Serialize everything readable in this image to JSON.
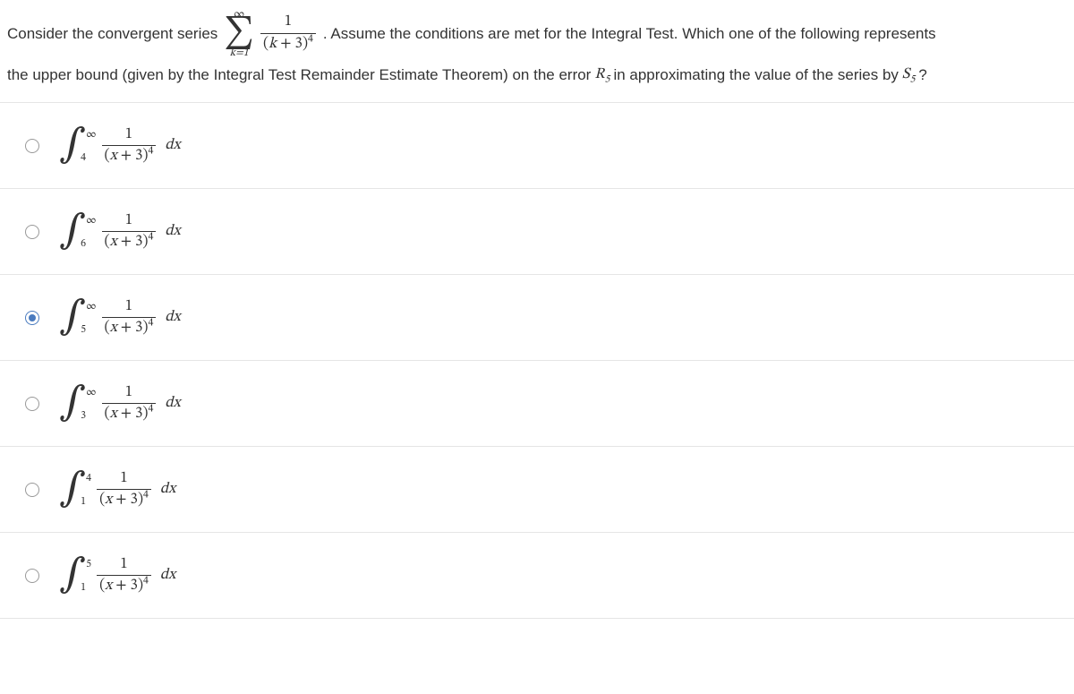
{
  "question": {
    "text_before_series": "Consider the convergent series",
    "series": {
      "sum_upper": "∞",
      "sum_symbol": "∑",
      "sum_lower": "k=1",
      "frac_num": "1",
      "frac_den_open": "(",
      "frac_den_var": "k",
      "frac_den_plus": " + 3)",
      "frac_den_exp": "4"
    },
    "text_middle": ". Assume the conditions are met for the Integral Test. Which one of the following represents",
    "text_second_line_a": "the upper bound (given by the Integral Test Remainder Estimate Theorem) on the error ",
    "r_var": "R",
    "r_sub": "5",
    "text_second_line_b": " in approximating the value of the series by ",
    "s_var": "S",
    "s_sub": "5",
    "text_end": " ?"
  },
  "integrand": {
    "num": "1",
    "den_open": "(",
    "den_var": "x",
    "den_plus": " + 3)",
    "den_exp": "4",
    "dx": "dx"
  },
  "options": [
    {
      "id": "a",
      "lower": "4",
      "upper": "∞",
      "selected": false
    },
    {
      "id": "b",
      "lower": "6",
      "upper": "∞",
      "selected": false
    },
    {
      "id": "c",
      "lower": "5",
      "upper": "∞",
      "selected": true
    },
    {
      "id": "d",
      "lower": "3",
      "upper": "∞",
      "selected": false
    },
    {
      "id": "e",
      "lower": "1",
      "upper": "4",
      "selected": false
    },
    {
      "id": "f",
      "lower": "1",
      "upper": "5",
      "selected": false
    }
  ]
}
